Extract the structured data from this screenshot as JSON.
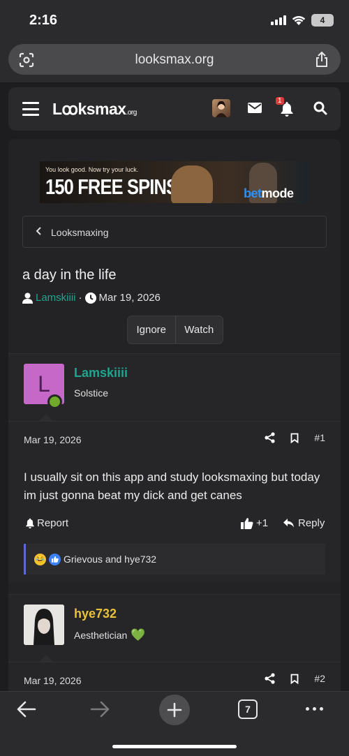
{
  "status_bar": {
    "time": "2:16",
    "battery": "4"
  },
  "browser": {
    "url": "looksmax.org"
  },
  "site": {
    "logo_main": "Lꝏksmax",
    "logo_tld": ".org",
    "notification_count": "1"
  },
  "ad": {
    "tagline": "You look good. Now try your luck.",
    "headline": "150 FREE SPINS",
    "brand_a": "bet",
    "brand_b": "mode"
  },
  "breadcrumb": {
    "label": "Looksmaxing"
  },
  "thread": {
    "title": "a day in the life",
    "author": "Lamskiiii",
    "separator": "·",
    "date": "Mar 19, 2026",
    "ignore_label": "Ignore",
    "watch_label": "Watch"
  },
  "posts": [
    {
      "avatar_letter": "L",
      "username": "Lamskiiii",
      "user_title": "Solstice",
      "date": "Mar 19, 2026",
      "number": "#1",
      "body": "I usually sit on this app and study looksmaxing but today im just gonna beat my dick and get canes",
      "report_label": "Report",
      "like_label": "+1",
      "reply_label": "Reply",
      "reactions_text": "Grievous and hye732"
    },
    {
      "username": "hye732",
      "user_title": "Aesthetician",
      "user_title_emoji": "💚",
      "date": "Mar 19, 2026",
      "number": "#2"
    }
  ],
  "toolbar": {
    "tab_count": "7"
  },
  "colors": {
    "background": "#1d1d1f",
    "author_green": "#1fa58f",
    "user_gold": "#e9c23a",
    "avatar_purple": "#c568c8",
    "online_green": "#71a92d",
    "reaction_border": "#5a6bd6"
  }
}
